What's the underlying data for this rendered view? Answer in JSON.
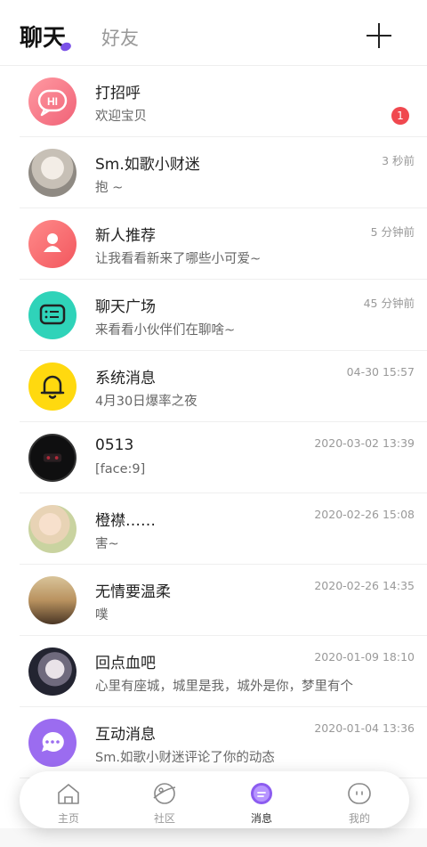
{
  "header": {
    "tab_chat": "聊天",
    "tab_friends": "好友"
  },
  "conversations": [
    {
      "name": "打招呼",
      "message": "欢迎宝贝",
      "time": "",
      "badge": "1",
      "avatar": "hi-bubble-icon"
    },
    {
      "name": "Sm.如歌小财迷",
      "message": "抱 ~",
      "time": "3 秒前",
      "avatar": "user-photo"
    },
    {
      "name": "新人推荐",
      "message": "让我看看新来了哪些小可爱~",
      "time": "5 分钟前",
      "avatar": "person-icon"
    },
    {
      "name": "聊天广场",
      "message": "来看看小伙伴们在聊啥~",
      "time": "45 分钟前",
      "avatar": "chat-list-icon"
    },
    {
      "name": "系统消息",
      "message": "4月30日爆率之夜",
      "time": "04-30 15:57",
      "avatar": "bell-icon"
    },
    {
      "name": "0513",
      "message": "[face:9]",
      "time": "2020-03-02 13:39",
      "avatar": "user-photo"
    },
    {
      "name": "橙襟……",
      "message": "害~",
      "time": "2020-02-26 15:08",
      "avatar": "user-photo"
    },
    {
      "name": "无情要温柔",
      "message": "噗",
      "time": "2020-02-26 14:35",
      "avatar": "user-photo"
    },
    {
      "name": "回点血吧",
      "message": "心里有座城，城里是我，城外是你，梦里有个",
      "time": "2020-01-09 18:10",
      "avatar": "user-photo"
    },
    {
      "name": "互动消息",
      "message": "Sm.如歌小财迷评论了你的动态",
      "time": "2020-01-04 13:36",
      "avatar": "speech-bubble-icon"
    }
  ],
  "nav": [
    {
      "label": "主页",
      "icon": "home-icon"
    },
    {
      "label": "社区",
      "icon": "planet-icon"
    },
    {
      "label": "消息",
      "icon": "message-icon"
    },
    {
      "label": "我的",
      "icon": "profile-icon"
    }
  ],
  "colors": {
    "accent": "#7b52e8",
    "badge": "#f0484f",
    "teal": "#2fd3b9",
    "yellow": "#ffd90f",
    "purple": "#9b6cf0"
  }
}
